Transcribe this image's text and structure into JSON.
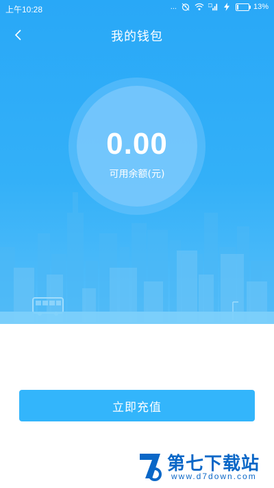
{
  "status_bar": {
    "time": "上午10:28",
    "dots": "...",
    "battery": "13%",
    "battery_level": 0.13,
    "icons": [
      "alarm-icon",
      "wifi-icon",
      "signal-hd-icon",
      "charging-icon"
    ]
  },
  "header": {
    "back_icon": "chevron-left-icon",
    "title": "我的钱包"
  },
  "balance": {
    "amount": "0.00",
    "label": "可用余额(元)"
  },
  "actions": {
    "recharge_label": "立即充值"
  },
  "watermark": {
    "name": "第七下载站",
    "url": "www.d7down.com"
  },
  "colors": {
    "hero_top": "#29a8f7",
    "hero_bottom": "#57bffa",
    "button": "#33b5fb",
    "watermark": "#0a67c7"
  }
}
